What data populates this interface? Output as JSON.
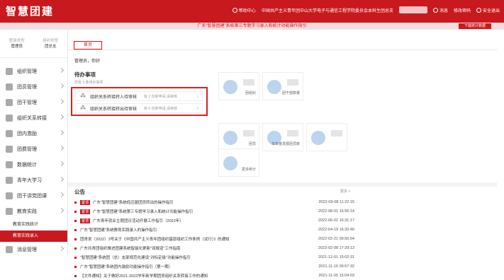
{
  "header": {
    "logo": "智慧团建",
    "nav": [
      "帮助中心",
      "中国共产主义青年团中山大学电子与通信工程学院委员会本科生团总支",
      "消息",
      "修改密码",
      "安全退出"
    ]
  },
  "banner": {
    "text": "广东“智慧团建”系统第三专题学习录入和统计功能操作指引",
    "button": "下载统计数据"
  },
  "sidebar": {
    "roles": [
      {
        "key": "登录类型",
        "value": "管理员"
      },
      {
        "key": "组织类型",
        "value": "团总支"
      }
    ],
    "items": [
      {
        "label": "组织管理"
      },
      {
        "label": "团员管理"
      },
      {
        "label": "团干管理"
      },
      {
        "label": "组织关系转接"
      },
      {
        "label": "团内激励"
      },
      {
        "label": "团费管理"
      },
      {
        "label": "数据统计"
      },
      {
        "label": "青年大学习"
      },
      {
        "label": "团干讲党团课"
      },
      {
        "label": "教育实践"
      }
    ],
    "subitems": [
      {
        "label": "教育实践统计"
      },
      {
        "label": "教育实践录入"
      }
    ],
    "last_item": {
      "label": "消息管理"
    }
  },
  "main": {
    "tab": "首页",
    "greeting": "管理员，你好",
    "todo": {
      "title": "待办事项",
      "subtitle": "您有 3 条待办事项",
      "rows": [
        {
          "label": "组织关系转接转入待审核",
          "note": "有 2 份新申请,请审核"
        },
        {
          "label": "组织关系转接转出待审核",
          "note": "有 0 份新申请,请审核"
        }
      ]
    },
    "stats": [
      {
        "label": "团组织"
      },
      {
        "label": "团干部数量"
      },
      {
        "label": "团员"
      },
      {
        "label": "本年度发展团员数"
      },
      {
        "label": "更多统计"
      }
    ],
    "announcements": {
      "title": "公告",
      "more": "更多 >",
      "rows": [
        {
          "badge": "置顶",
          "title": "广东“智慧团建”系统低应届团员转出的操作指引",
          "date": "2022-09-08 11:22:15"
        },
        {
          "badge": "置顶",
          "title": "广东“智慧团建”系统第三专题学习录入和统计功能操作指引",
          "date": "2022-08-01 16:56:14"
        },
        {
          "badge": "置顶",
          "title": "广东青年就业主题团日活动开展工作指引（2022年）",
          "date": "2022-06-02 16:31:17"
        },
        {
          "badge": "",
          "title": "广东“智慧团建”系统教育实践录入的操作指引",
          "date": "2022-04-19 16:20:40"
        },
        {
          "badge": "",
          "title": "团青发〔2022〕3号关于《中国共产主义青年团组织基层组织工作条例（试行）》的通知",
          "date": "2022-02-21 09:56:54"
        },
        {
          "badge": "",
          "title": "广东共青团组织推进团建系统智能化更新\"双报道\"工作指南",
          "date": "2022-02-08 17:29:13"
        },
        {
          "badge": "",
          "title": "“智慧团建”系统团（总）支部规范化建设“对标定级”功能操作指引",
          "date": "2021-12-01 15:02:31"
        },
        {
          "badge": "",
          "title": "广东“智慧团建”系统团内激励功能操作指引（第一期）",
          "date": "2021-11-16 09:57:32"
        },
        {
          "badge": "",
          "title": "【文件通知】关于做好2021-2022学年新学期团员组织关系转接工作的通知",
          "date": "2021-11-05 15:04:03"
        }
      ]
    }
  }
}
